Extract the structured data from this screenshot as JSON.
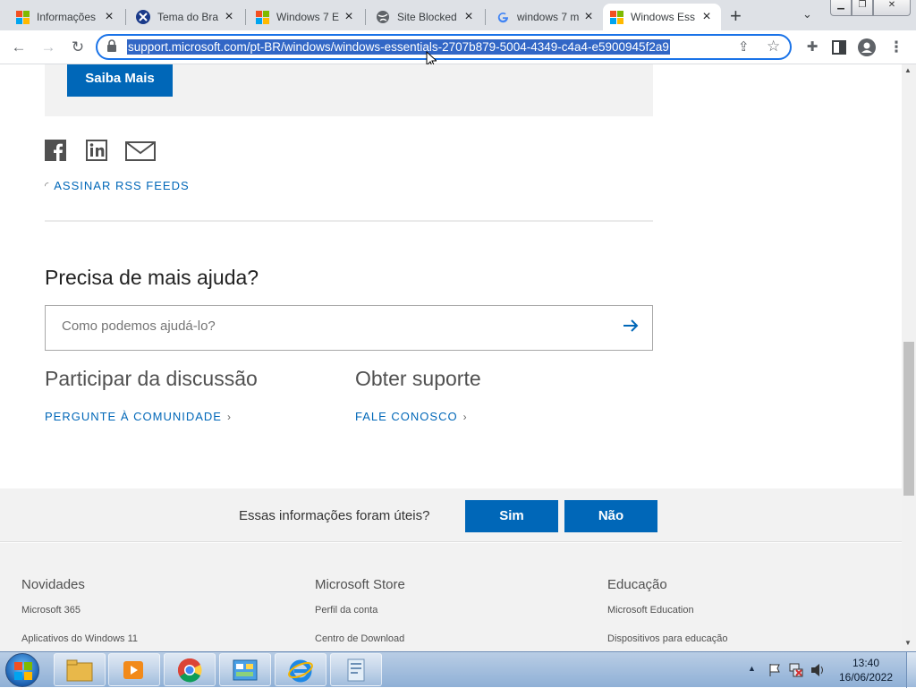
{
  "browser": {
    "tabs": [
      {
        "title": "Informações"
      },
      {
        "title": "Tema do Bra"
      },
      {
        "title": "Windows 7 E"
      },
      {
        "title": "Site Blocked"
      },
      {
        "title": "windows 7 m"
      },
      {
        "title": "Windows Ess"
      }
    ],
    "new_tab": "+",
    "url": "support.microsoft.com/pt-BR/windows/windows-essentials-2707b879-5004-4349-c4a4-e5900945f2a9"
  },
  "page": {
    "learn_more_button": "Saiba Mais",
    "rss_link": "ASSINAR RSS FEEDS",
    "help_heading": "Precisa de mais ajuda?",
    "search_placeholder": "Como podemos ajudá-lo?",
    "discussion_heading": "Participar da discussão",
    "discussion_link": "PERGUNTE À COMUNIDADE",
    "support_heading": "Obter suporte",
    "support_link": "FALE CONOSCO",
    "feedback_question": "Essas informações foram úteis?",
    "yes_button": "Sim",
    "no_button": "Não",
    "footer": {
      "columns": [
        {
          "heading": "Novidades",
          "links": [
            "Microsoft 365",
            "Aplicativos do Windows 11"
          ]
        },
        {
          "heading": "Microsoft Store",
          "links": [
            "Perfil da conta",
            "Centro de Download"
          ]
        },
        {
          "heading": "Educação",
          "links": [
            "Microsoft Education",
            "Dispositivos para educação"
          ]
        }
      ]
    }
  },
  "taskbar": {
    "time": "13:40",
    "date": "16/06/2022"
  },
  "colors": {
    "accent": "#0067b8",
    "link": "#0067b8",
    "selection": "#3267c6"
  }
}
